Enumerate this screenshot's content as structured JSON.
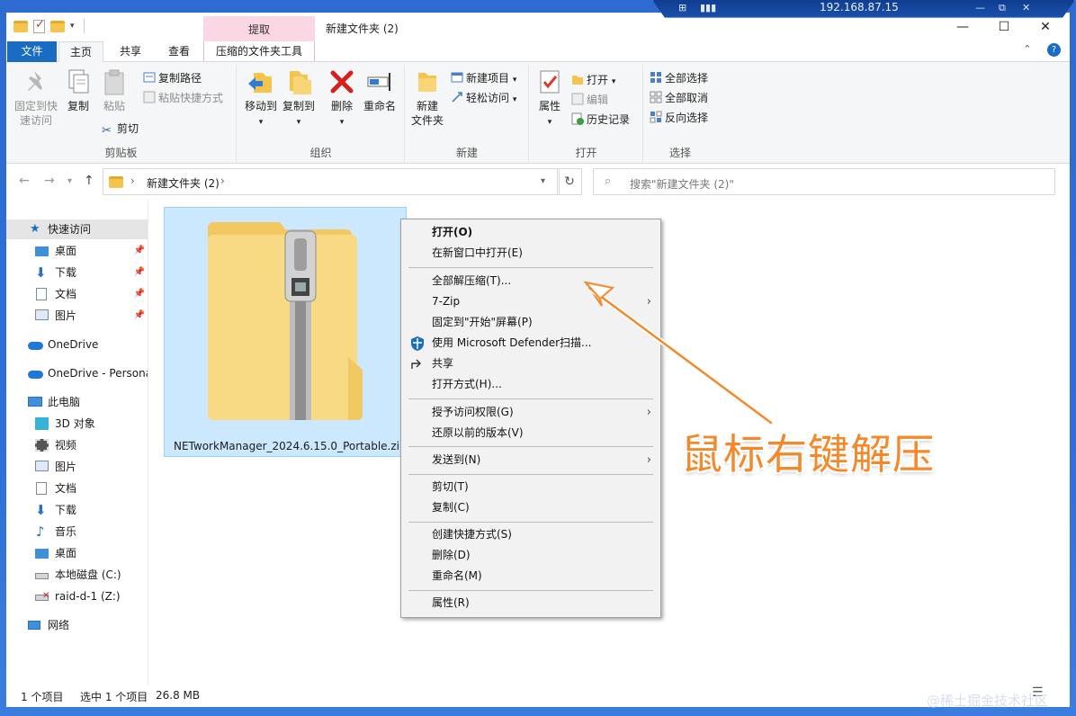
{
  "remote": {
    "ip": "192.168.87.15"
  },
  "window": {
    "title": "新建文件夹 (2)",
    "context_tab_header": "提取",
    "minimize": "—",
    "maximize": "☐",
    "close": "✕"
  },
  "tabs": {
    "file": "文件",
    "home": "主页",
    "share": "共享",
    "view": "查看",
    "tool": "压缩的文件夹工具"
  },
  "ribbon": {
    "clipboard": {
      "label": "剪贴板",
      "pin": "固定到快速访问",
      "pin_l1": "固定到快",
      "pin_l2": "速访问",
      "copy": "复制",
      "paste": "粘贴",
      "copy_path": "复制路径",
      "paste_shortcut": "粘贴快捷方式",
      "cut": "剪切"
    },
    "organize": {
      "label": "组织",
      "move_to": "移动到",
      "copy_to": "复制到",
      "delete": "删除",
      "rename": "重命名"
    },
    "new": {
      "label": "新建",
      "new_folder_l1": "新建",
      "new_folder_l2": "文件夹",
      "new_item": "新建项目",
      "easy_access": "轻松访问"
    },
    "open": {
      "label": "打开",
      "properties": "属性",
      "open": "打开",
      "edit": "编辑",
      "history": "历史记录"
    },
    "select": {
      "label": "选择",
      "select_all": "全部选择",
      "select_none": "全部取消",
      "invert": "反向选择"
    }
  },
  "address": {
    "crumb": "新建文件夹 (2)",
    "search_placeholder": "搜索\"新建文件夹 (2)\""
  },
  "nav": {
    "quick_access": "快速访问",
    "qa_items": [
      "桌面",
      "下载",
      "文档",
      "图片"
    ],
    "onedrive": "OneDrive",
    "onedrive_personal": "OneDrive - Persona",
    "this_pc": "此电脑",
    "pc_items": [
      "3D 对象",
      "视频",
      "图片",
      "文档",
      "下载",
      "音乐",
      "桌面",
      "本地磁盘 (C:)",
      "raid-d-1 (Z:)"
    ],
    "network": "网络"
  },
  "file": {
    "name": "NETworkManager_2024.6.15.0_Portable.zip"
  },
  "context_menu": {
    "open": "打开(O)",
    "open_new_window": "在新窗口中打开(E)",
    "extract_all": "全部解压缩(T)...",
    "seven_zip": "7-Zip",
    "pin_start": "固定到\"开始\"屏幕(P)",
    "defender": "使用 Microsoft Defender扫描...",
    "share": "共享",
    "open_with": "打开方式(H)...",
    "grant_access": "授予访问权限(G)",
    "restore": "还原以前的版本(V)",
    "send_to": "发送到(N)",
    "cut": "剪切(T)",
    "copy": "复制(C)",
    "create_shortcut": "创建快捷方式(S)",
    "delete": "删除(D)",
    "rename": "重命名(M)",
    "properties": "属性(R)"
  },
  "annotation": "鼠标右键解压",
  "status": {
    "count": "1 个项目",
    "selected": "选中 1 个项目",
    "size": "26.8 MB"
  },
  "watermark": "@稀土掘金技术社区",
  "colors": {
    "accent": "#1a6bc2",
    "selection": "#cce8ff",
    "annotation": "#f4892b",
    "context_tab": "#fbd6e3"
  }
}
